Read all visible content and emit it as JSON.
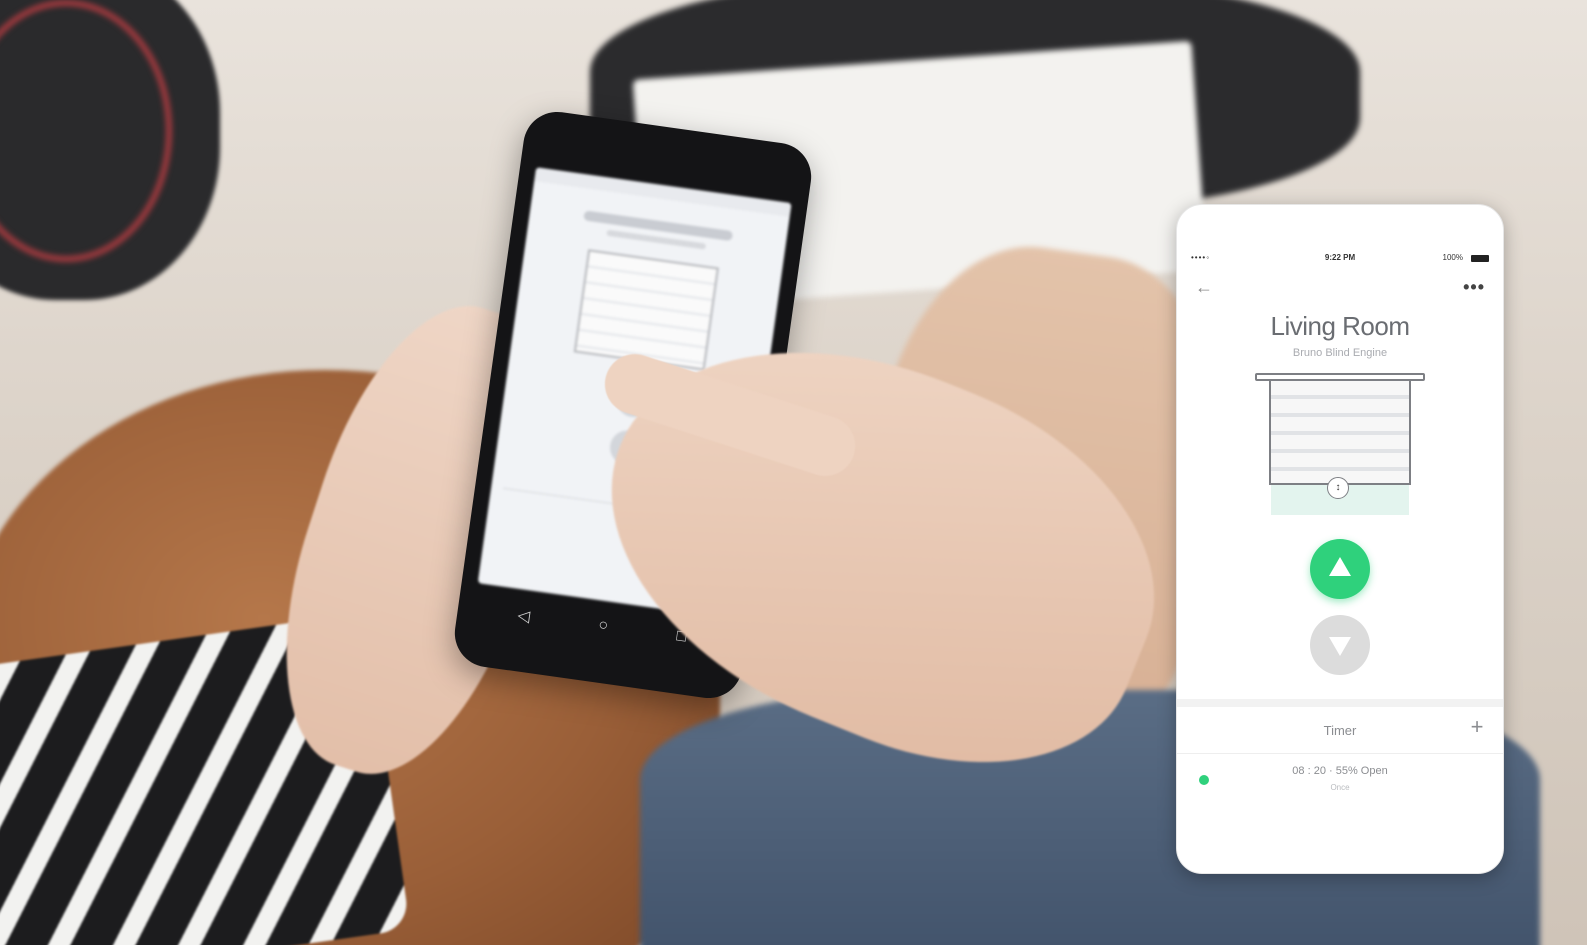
{
  "ios_app": {
    "status_bar": {
      "signal": "••••◦",
      "time": "9:22 PM",
      "battery": "100%"
    },
    "title": "Living Room",
    "subtitle": "Bruno Blind Engine",
    "blind_handle_glyph": "↕",
    "timer_section": {
      "label": "Timer",
      "add_symbol": "+"
    },
    "timer_entries": [
      {
        "schedule": "08 : 20 · 55% Open",
        "repeat": "Once",
        "active": true
      }
    ],
    "colors": {
      "accent": "#2fd17c",
      "inactive_button": "#dcdcdc"
    }
  },
  "android_app": {
    "nav_back": "◁",
    "nav_home": "○",
    "nav_recent": "□"
  }
}
